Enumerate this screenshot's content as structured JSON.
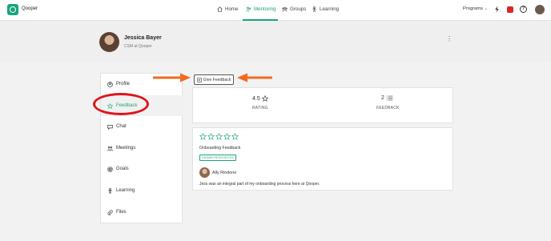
{
  "app": {
    "brand": "Qooper"
  },
  "nav": {
    "items": [
      {
        "label": "Home",
        "icon": "home-icon"
      },
      {
        "label": "Mentoring",
        "icon": "mentoring-icon",
        "active": true
      },
      {
        "label": "Groups",
        "icon": "groups-icon"
      },
      {
        "label": "Learning",
        "icon": "learning-icon"
      }
    ],
    "programs_label": "Programs",
    "help_label": "?"
  },
  "profile": {
    "name": "Jessica Bayer",
    "role": "CSM at Qooper",
    "menu_label": "⋮"
  },
  "sidebar": {
    "items": [
      {
        "label": "Profile",
        "icon": "profile-icon"
      },
      {
        "label": "Feedback",
        "icon": "star-icon",
        "active": true
      },
      {
        "label": "Chat",
        "icon": "chat-icon"
      },
      {
        "label": "Meetings",
        "icon": "meetings-icon"
      },
      {
        "label": "Goals",
        "icon": "goals-icon"
      },
      {
        "label": "Learning",
        "icon": "learning-icon"
      },
      {
        "label": "Files",
        "icon": "files-icon"
      }
    ]
  },
  "give_feedback": {
    "label": "Give Feedback"
  },
  "stats": {
    "rating_value": "4.5",
    "rating_label": "RATING",
    "feedback_value": "2",
    "feedback_label": "FEEDBACK"
  },
  "feedback_entry": {
    "stars": 0,
    "title": "Onboarding Feedback",
    "tag": "HUMAN RESOURCES",
    "author": "Ally Rindone",
    "body": "Jess was an integral part of my onboarding process here at Qooper."
  },
  "colors": {
    "accent": "#1aa37f",
    "annotation": "#e0141b",
    "arrow": "#f26a21"
  }
}
